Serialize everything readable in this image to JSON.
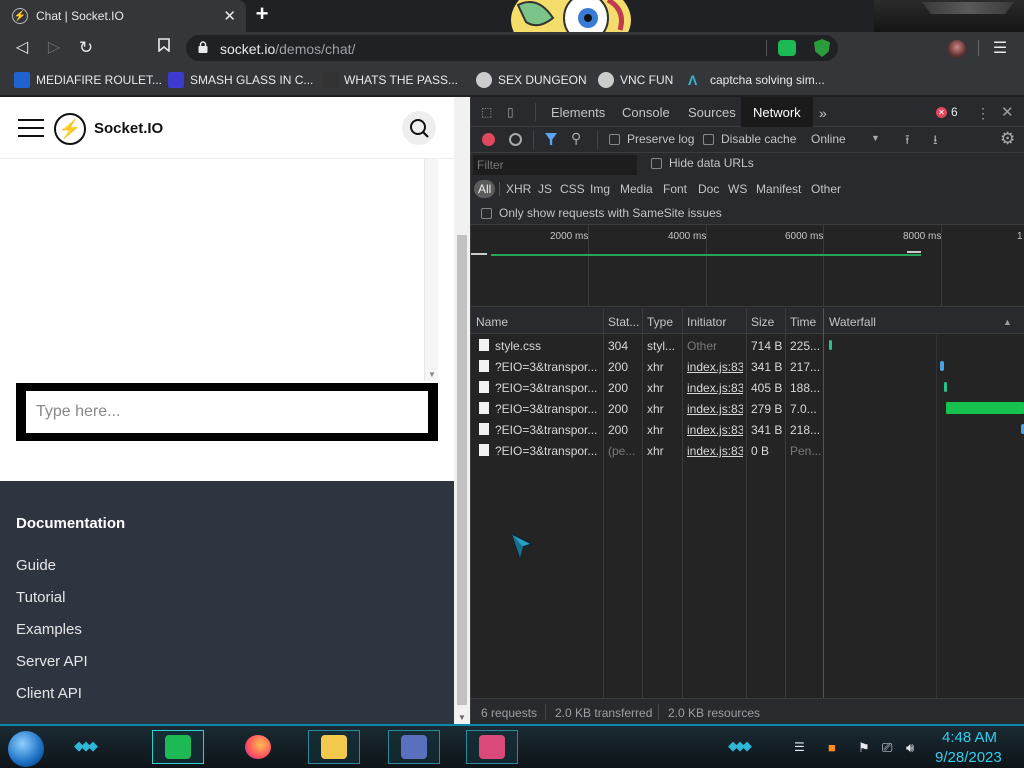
{
  "browser": {
    "tab_title": "Chat | Socket.IO",
    "url_host": "socket.io",
    "url_path": "/demos/chat/",
    "bookmarks": [
      {
        "label": "MEDIAFIRE ROULET...",
        "color": "#1f63d0"
      },
      {
        "label": "SMASH GLASS IN C...",
        "color": "#3b3bd0"
      },
      {
        "label": "WHATS THE PASS...",
        "color": "#333333"
      },
      {
        "label": "SEX DUNGEON",
        "color": "#cccccc"
      },
      {
        "label": "VNC FUN",
        "color": "#cccccc"
      },
      {
        "label": "captcha solving sim...",
        "color": "#2fb7d8"
      }
    ]
  },
  "site": {
    "brand": "Socket.IO",
    "chat_placeholder": "Type here...",
    "footer": {
      "title": "Documentation",
      "links": [
        "Guide",
        "Tutorial",
        "Examples",
        "Server API",
        "Client API"
      ]
    }
  },
  "devtools": {
    "tabs": [
      "Elements",
      "Console",
      "Sources",
      "Network"
    ],
    "active_tab": "Network",
    "error_count": "6",
    "toolbar": {
      "preserve_log": "Preserve log",
      "disable_cache": "Disable cache",
      "throttling": "Online"
    },
    "filter_placeholder": "Filter",
    "hide_data_urls": "Hide data URLs",
    "types": [
      "All",
      "XHR",
      "JS",
      "CSS",
      "Img",
      "Media",
      "Font",
      "Doc",
      "WS",
      "Manifest",
      "Other"
    ],
    "samesite_label": "Only show requests with SameSite issues",
    "overview_ticks": [
      "2000 ms",
      "4000 ms",
      "6000 ms",
      "8000 ms",
      "1"
    ],
    "columns": [
      "Name",
      "Stat...",
      "Type",
      "Initiator",
      "Size",
      "Time",
      "Waterfall"
    ],
    "requests": [
      {
        "name": "style.css",
        "status": "304",
        "type": "styl...",
        "initiator": "Other",
        "size": "714 B",
        "time": "225..."
      },
      {
        "name": "?EIO=3&transpor...",
        "status": "200",
        "type": "xhr",
        "initiator": "index.js:83",
        "size": "341 B",
        "time": "217..."
      },
      {
        "name": "?EIO=3&transpor...",
        "status": "200",
        "type": "xhr",
        "initiator": "index.js:83",
        "size": "405 B",
        "time": "188..."
      },
      {
        "name": "?EIO=3&transpor...",
        "status": "200",
        "type": "xhr",
        "initiator": "index.js:83",
        "size": "279 B",
        "time": "7.0..."
      },
      {
        "name": "?EIO=3&transpor...",
        "status": "200",
        "type": "xhr",
        "initiator": "index.js:83",
        "size": "341 B",
        "time": "218..."
      },
      {
        "name": "?EIO=3&transpor...",
        "status": "(pe...",
        "type": "xhr",
        "initiator": "index.js:83",
        "size": "0 B",
        "time": "Pen..."
      }
    ],
    "status_bar": {
      "requests": "6 requests",
      "transferred": "2.0 KB transferred",
      "resources": "2.0 KB resources"
    }
  },
  "taskbar": {
    "time": "4:48 AM",
    "date": "9/28/2023"
  }
}
